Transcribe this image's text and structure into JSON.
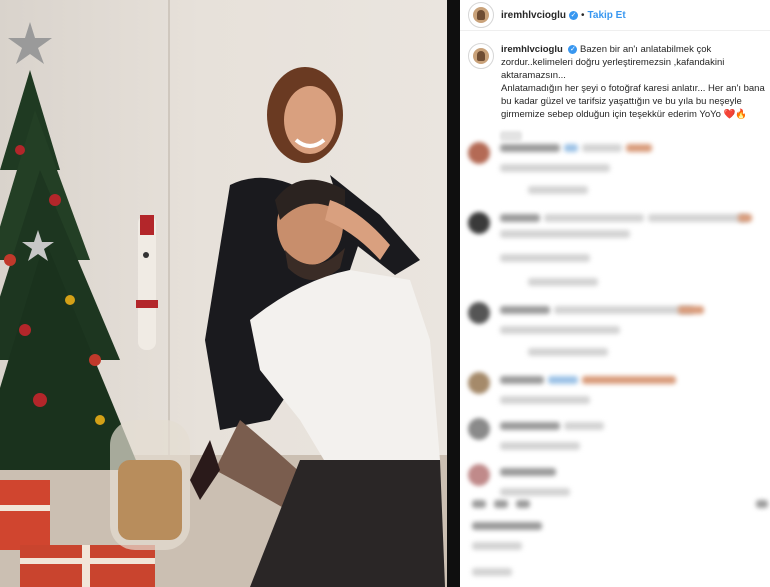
{
  "post": {
    "username": "iremhlvcioglu",
    "verified_mark": "✓",
    "separator": "•",
    "follow_label": "Takip Et",
    "caption": {
      "username": "iremhlvcioglu",
      "line1": "Bazen bir an'ı anlatabilmek çok zordur..kelimeleri doğru yerleştiremezsin ,kafandakini aktaramazsın...",
      "line2": "Anlatamadığın her şeyi o fotoğraf karesi anlatır... Her an'ı bana bu kadar güzel ve tarifsiz yaşattığın ve bu yıla bu neşeyle girmemize sebep olduğun için teşekkür ederim YoYo",
      "emojis": "❤️🔥"
    }
  },
  "icons": {
    "verified": "verified-badge-icon",
    "avatar": "profile-avatar"
  },
  "colors": {
    "link": "#3897f0",
    "text": "#262626",
    "background": "#ffffff",
    "frame": "#111111"
  }
}
